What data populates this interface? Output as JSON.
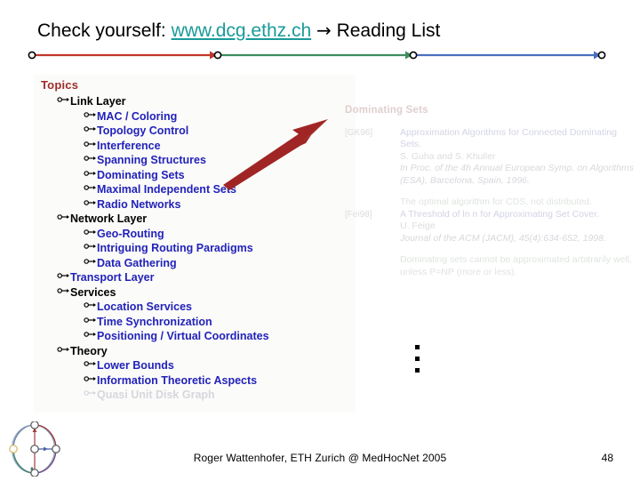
{
  "slide": {
    "title_prefix": "Check yourself: ",
    "title_url": "www.dcg.ethz.ch",
    "title_arrow": "→",
    "title_suffix": " Reading List",
    "colors": {
      "url": "#1a9a9a",
      "heading_maroon": "#9e2b29",
      "topic_blue": "#2222bb",
      "arrow_red": "#a02525",
      "timeline_red": "#c0392b",
      "timeline_green": "#3c8c5f",
      "timeline_blue": "#4a6fbf"
    }
  },
  "timeline": {
    "segments": [
      {
        "label": "segment-red",
        "color": "#c0392b"
      },
      {
        "label": "segment-green",
        "color": "#3c8c5f"
      },
      {
        "label": "segment-blue",
        "color": "#4a6fbf"
      }
    ],
    "node_count": 4
  },
  "topics": {
    "heading": "Topics",
    "items": [
      {
        "label": "Link Layer",
        "level": 1,
        "color": "black"
      },
      {
        "label": "MAC / Coloring",
        "level": 2,
        "color": "blue"
      },
      {
        "label": "Topology Control",
        "level": 2,
        "color": "blue"
      },
      {
        "label": "Interference",
        "level": 2,
        "color": "blue"
      },
      {
        "label": "Spanning Structures",
        "level": 2,
        "color": "blue"
      },
      {
        "label": "Dominating Sets",
        "level": 2,
        "color": "blue"
      },
      {
        "label": "Maximal Independent Sets",
        "level": 2,
        "color": "blue"
      },
      {
        "label": "Radio Networks",
        "level": 2,
        "color": "blue"
      },
      {
        "label": "Network Layer",
        "level": 1,
        "color": "black"
      },
      {
        "label": "Geo-Routing",
        "level": 2,
        "color": "blue"
      },
      {
        "label": "Intriguing Routing Paradigms",
        "level": 2,
        "color": "blue"
      },
      {
        "label": "Data Gathering",
        "level": 2,
        "color": "blue"
      },
      {
        "label": "Transport Layer",
        "level": 1,
        "color": "blue"
      },
      {
        "label": "Services",
        "level": 1,
        "color": "black"
      },
      {
        "label": "Location Services",
        "level": 2,
        "color": "blue"
      },
      {
        "label": "Time Synchronization",
        "level": 2,
        "color": "blue"
      },
      {
        "label": "Positioning / Virtual Coordinates",
        "level": 2,
        "color": "blue"
      },
      {
        "label": "Theory",
        "level": 1,
        "color": "black"
      },
      {
        "label": "Lower Bounds",
        "level": 2,
        "color": "blue"
      },
      {
        "label": "Information Theoretic Aspects",
        "level": 2,
        "color": "blue"
      },
      {
        "label": "Quasi Unit Disk Graph",
        "level": 2,
        "color": "faint"
      }
    ]
  },
  "reading_list": {
    "heading": "Dominating Sets",
    "entries": [
      {
        "key": "[GK96]",
        "title": "Approximation Algorithms for Connected Dominating Sets.",
        "authors": "S. Guha and S. Khuller",
        "venue": "In Proc. of the 4h Annual European Symp. on Algorithms (ESA), Barcelona, Spain, 1996.",
        "note": "The optimal algorithm for CDS, not distributed."
      },
      {
        "key": "[Fei98]",
        "title": "A Threshold of ln n for Approximating Set Cover.",
        "authors": "U. Feige",
        "venue": "Journal of the ACM (JACM), 45(4):634-652, 1998.",
        "note": "Dominating sets cannot be approximated arbitrarily well, unless P=NP (more or less)."
      }
    ],
    "continuation_bullets": 3
  },
  "footer": {
    "text": "Roger Wattenhofer, ETH Zurich @ MedHocNet 2005",
    "page_number": "48",
    "logo_name": "dcg-logo"
  }
}
